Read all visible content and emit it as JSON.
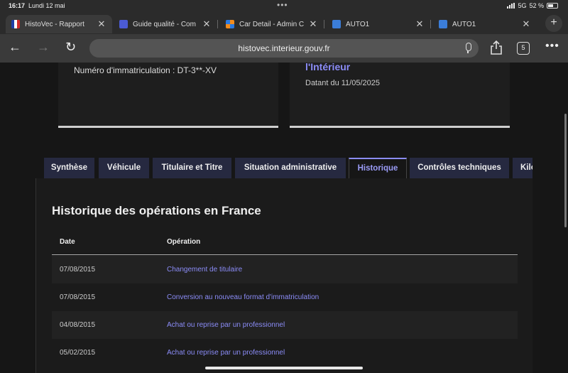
{
  "status": {
    "time": "16:17",
    "date": "Lundi 12 mai",
    "network": "5G",
    "battery": "52 %"
  },
  "tabs": [
    {
      "label": "HistoVec - Rapport",
      "icon": "french-flag-icon",
      "active": true
    },
    {
      "label": "Guide qualité - Com",
      "icon": "document-icon",
      "active": false
    },
    {
      "label": "Car Detail - Admin C",
      "icon": "car-admin-icon",
      "active": false
    },
    {
      "label": "AUTO1",
      "icon": "auto1-icon",
      "active": false
    },
    {
      "label": "AUTO1",
      "icon": "auto1-icon",
      "active": false
    }
  ],
  "address": {
    "url": "histovec.interieur.gouv.fr",
    "tab_count": "5"
  },
  "cards": {
    "plate": "Numéro d'immatriculation : DT-3**-XV",
    "source_title": "l'Intérieur",
    "since": "Datant du 11/05/2025"
  },
  "page_tabs": [
    "Synthèse",
    "Véhicule",
    "Titulaire et Titre",
    "Situation administrative",
    "Historique",
    "Contrôles techniques",
    "Kilo"
  ],
  "history": {
    "title": "Historique des opérations en France",
    "columns": [
      "Date",
      "Opération"
    ],
    "rows": [
      {
        "date": "07/08/2015",
        "operation": "Changement de titulaire"
      },
      {
        "date": "07/08/2015",
        "operation": "Conversion au nouveau format d'immatriculation"
      },
      {
        "date": "04/08/2015",
        "operation": "Achat ou reprise par un professionnel"
      },
      {
        "date": "05/02/2015",
        "operation": "Achat ou reprise par un professionnel"
      }
    ]
  },
  "colors": {
    "accent": "#8b8cf7",
    "tab_bg": "#262940",
    "background": "#161616"
  }
}
